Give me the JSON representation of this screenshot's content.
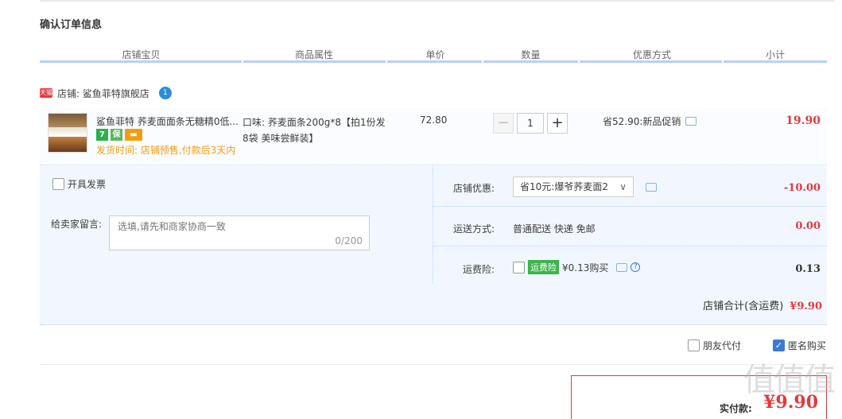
{
  "page": {
    "title": "确认订单信息"
  },
  "columns": [
    "店铺宝贝",
    "商品属性",
    "单价",
    "数量",
    "优惠方式",
    "小计"
  ],
  "shop": {
    "badge": "天猫",
    "label": "店铺: 鲨鱼菲特旗舰店",
    "ww": "1"
  },
  "item": {
    "title": "鲨鱼菲特 荞麦面面条无糖精0低...",
    "service_icons": [
      "7",
      "保",
      "▬"
    ],
    "ship_time": "发货时间: 店铺预售,付款后3天内",
    "attr": "口味: 荞麦面条200g*8【拍1份发8袋 美味尝鲜装】",
    "price": "72.80",
    "qty_minus": "−",
    "qty": "1",
    "qty_plus": "+",
    "promo": "省52.90:新品促销",
    "subtotal": "19.90"
  },
  "invoice": {
    "label": "开具发票"
  },
  "memo": {
    "label": "给卖家留言:",
    "placeholder": "选填,请先和商家协商一致",
    "count": "0/200"
  },
  "shop_discount": {
    "label": "店铺优惠:",
    "selected": "省10元:爆爷荞麦面2",
    "chev": "∨",
    "amount": "-10.00"
  },
  "shipping": {
    "label": "运送方式:",
    "value": "普通配送 快递 免邮",
    "amount": "0.00"
  },
  "insurance": {
    "label": "运费险:",
    "badge": "运费险",
    "text": "¥0.13购买",
    "q": "?",
    "amount": "0.13"
  },
  "shop_total": {
    "label": "店铺合计(含运费)",
    "amount": "¥9.90"
  },
  "bottom": {
    "friend_pay": "朋友代付",
    "anonymous": "匿名购买",
    "check": "✓"
  },
  "pay": {
    "label": "实付款:",
    "amount": "¥9.90"
  },
  "watermark": "值值值"
}
